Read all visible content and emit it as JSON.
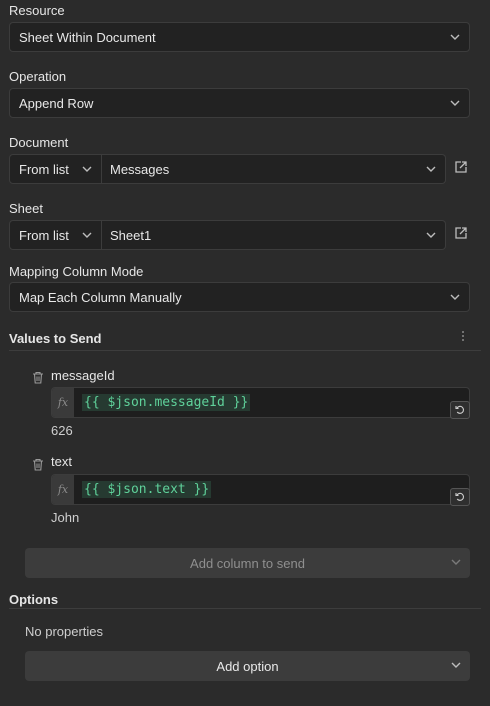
{
  "resource": {
    "label": "Resource",
    "value": "Sheet Within Document"
  },
  "operation": {
    "label": "Operation",
    "value": "Append Row"
  },
  "document": {
    "label": "Document",
    "mode": "From list",
    "value": "Messages"
  },
  "sheet": {
    "label": "Sheet",
    "mode": "From list",
    "value": "Sheet1"
  },
  "mapping": {
    "label": "Mapping Column Mode",
    "value": "Map Each Column Manually"
  },
  "values_section": {
    "title": "Values to Send",
    "fields": [
      {
        "name": "messageId",
        "expression": "{{ $json.messageId }}",
        "result": "626"
      },
      {
        "name": "text",
        "expression": "{{ $json.text }}",
        "result": "John"
      }
    ],
    "add_column_label": "Add column to send"
  },
  "options_section": {
    "title": "Options",
    "empty_text": "No properties",
    "add_option_label": "Add option"
  },
  "icons": {
    "fx": "fx"
  },
  "colors": {
    "background": "#2b2b2b",
    "input_bg": "#222222",
    "expression_text": "#5fd19a"
  }
}
